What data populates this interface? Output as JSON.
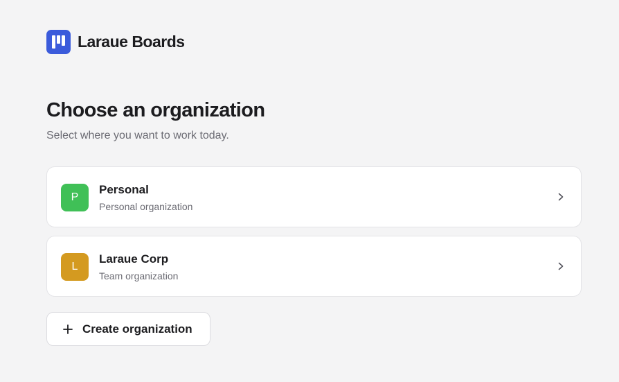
{
  "brand": {
    "name": "Laraue Boards",
    "logo_icon": "kanban-board-icon",
    "logo_color": "#3b5bdb"
  },
  "page": {
    "title": "Choose an organization",
    "subtitle": "Select where you want to work today."
  },
  "organizations": [
    {
      "initial": "P",
      "name": "Personal",
      "type": "Personal organization",
      "avatar_color": "#40c057",
      "chevron_icon": "chevron-right-icon"
    },
    {
      "initial": "L",
      "name": "Laraue Corp",
      "type": "Team organization",
      "avatar_color": "#d49a20",
      "chevron_icon": "chevron-right-icon"
    }
  ],
  "create_button": {
    "label": "Create organization",
    "icon": "plus-icon"
  },
  "colors": {
    "background": "#f4f4f5",
    "card": "#ffffff",
    "text": "#1c1c1f",
    "muted_text": "#6b6b73"
  }
}
